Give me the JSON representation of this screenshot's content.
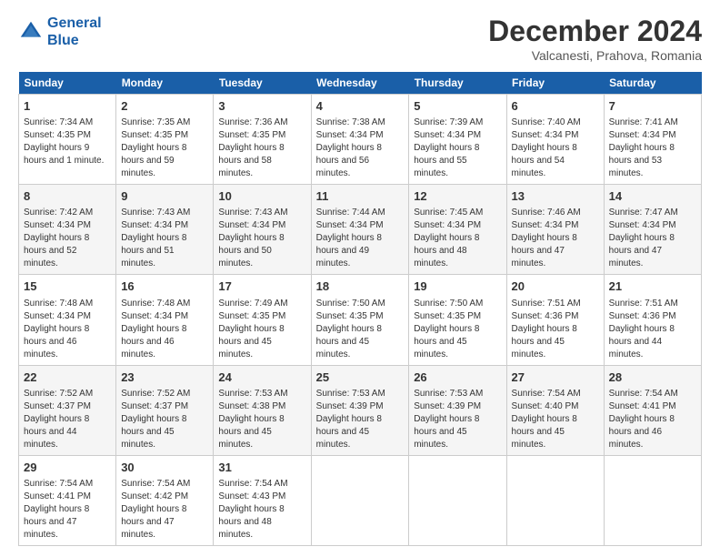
{
  "header": {
    "logo_line1": "General",
    "logo_line2": "Blue",
    "month": "December 2024",
    "location": "Valcanesti, Prahova, Romania"
  },
  "days_of_week": [
    "Sunday",
    "Monday",
    "Tuesday",
    "Wednesday",
    "Thursday",
    "Friday",
    "Saturday"
  ],
  "weeks": [
    [
      {
        "day": 1,
        "sunrise": "7:34 AM",
        "sunset": "4:35 PM",
        "daylight": "9 hours and 1 minute."
      },
      {
        "day": 2,
        "sunrise": "7:35 AM",
        "sunset": "4:35 PM",
        "daylight": "8 hours and 59 minutes."
      },
      {
        "day": 3,
        "sunrise": "7:36 AM",
        "sunset": "4:35 PM",
        "daylight": "8 hours and 58 minutes."
      },
      {
        "day": 4,
        "sunrise": "7:38 AM",
        "sunset": "4:34 PM",
        "daylight": "8 hours and 56 minutes."
      },
      {
        "day": 5,
        "sunrise": "7:39 AM",
        "sunset": "4:34 PM",
        "daylight": "8 hours and 55 minutes."
      },
      {
        "day": 6,
        "sunrise": "7:40 AM",
        "sunset": "4:34 PM",
        "daylight": "8 hours and 54 minutes."
      },
      {
        "day": 7,
        "sunrise": "7:41 AM",
        "sunset": "4:34 PM",
        "daylight": "8 hours and 53 minutes."
      }
    ],
    [
      {
        "day": 8,
        "sunrise": "7:42 AM",
        "sunset": "4:34 PM",
        "daylight": "8 hours and 52 minutes."
      },
      {
        "day": 9,
        "sunrise": "7:43 AM",
        "sunset": "4:34 PM",
        "daylight": "8 hours and 51 minutes."
      },
      {
        "day": 10,
        "sunrise": "7:43 AM",
        "sunset": "4:34 PM",
        "daylight": "8 hours and 50 minutes."
      },
      {
        "day": 11,
        "sunrise": "7:44 AM",
        "sunset": "4:34 PM",
        "daylight": "8 hours and 49 minutes."
      },
      {
        "day": 12,
        "sunrise": "7:45 AM",
        "sunset": "4:34 PM",
        "daylight": "8 hours and 48 minutes."
      },
      {
        "day": 13,
        "sunrise": "7:46 AM",
        "sunset": "4:34 PM",
        "daylight": "8 hours and 47 minutes."
      },
      {
        "day": 14,
        "sunrise": "7:47 AM",
        "sunset": "4:34 PM",
        "daylight": "8 hours and 47 minutes."
      }
    ],
    [
      {
        "day": 15,
        "sunrise": "7:48 AM",
        "sunset": "4:34 PM",
        "daylight": "8 hours and 46 minutes."
      },
      {
        "day": 16,
        "sunrise": "7:48 AM",
        "sunset": "4:34 PM",
        "daylight": "8 hours and 46 minutes."
      },
      {
        "day": 17,
        "sunrise": "7:49 AM",
        "sunset": "4:35 PM",
        "daylight": "8 hours and 45 minutes."
      },
      {
        "day": 18,
        "sunrise": "7:50 AM",
        "sunset": "4:35 PM",
        "daylight": "8 hours and 45 minutes."
      },
      {
        "day": 19,
        "sunrise": "7:50 AM",
        "sunset": "4:35 PM",
        "daylight": "8 hours and 45 minutes."
      },
      {
        "day": 20,
        "sunrise": "7:51 AM",
        "sunset": "4:36 PM",
        "daylight": "8 hours and 45 minutes."
      },
      {
        "day": 21,
        "sunrise": "7:51 AM",
        "sunset": "4:36 PM",
        "daylight": "8 hours and 44 minutes."
      }
    ],
    [
      {
        "day": 22,
        "sunrise": "7:52 AM",
        "sunset": "4:37 PM",
        "daylight": "8 hours and 44 minutes."
      },
      {
        "day": 23,
        "sunrise": "7:52 AM",
        "sunset": "4:37 PM",
        "daylight": "8 hours and 45 minutes."
      },
      {
        "day": 24,
        "sunrise": "7:53 AM",
        "sunset": "4:38 PM",
        "daylight": "8 hours and 45 minutes."
      },
      {
        "day": 25,
        "sunrise": "7:53 AM",
        "sunset": "4:39 PM",
        "daylight": "8 hours and 45 minutes."
      },
      {
        "day": 26,
        "sunrise": "7:53 AM",
        "sunset": "4:39 PM",
        "daylight": "8 hours and 45 minutes."
      },
      {
        "day": 27,
        "sunrise": "7:54 AM",
        "sunset": "4:40 PM",
        "daylight": "8 hours and 45 minutes."
      },
      {
        "day": 28,
        "sunrise": "7:54 AM",
        "sunset": "4:41 PM",
        "daylight": "8 hours and 46 minutes."
      }
    ],
    [
      {
        "day": 29,
        "sunrise": "7:54 AM",
        "sunset": "4:41 PM",
        "daylight": "8 hours and 47 minutes."
      },
      {
        "day": 30,
        "sunrise": "7:54 AM",
        "sunset": "4:42 PM",
        "daylight": "8 hours and 47 minutes."
      },
      {
        "day": 31,
        "sunrise": "7:54 AM",
        "sunset": "4:43 PM",
        "daylight": "8 hours and 48 minutes."
      },
      null,
      null,
      null,
      null
    ]
  ],
  "labels": {
    "sunrise": "Sunrise: ",
    "sunset": "Sunset: ",
    "daylight": "Daylight hours"
  }
}
